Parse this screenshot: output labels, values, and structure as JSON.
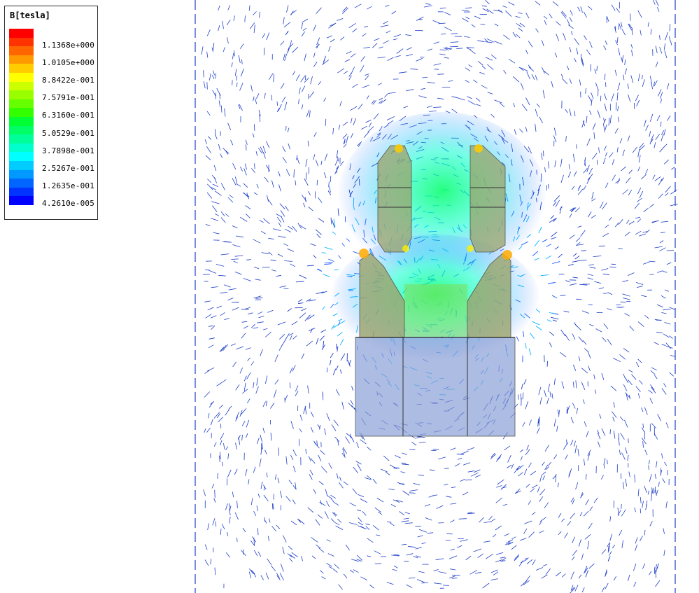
{
  "legend": {
    "title": "B[tesla]",
    "colors": [
      "#ff0000",
      "#ff3300",
      "#ff6600",
      "#ff9900",
      "#ffcc00",
      "#ffff00",
      "#ccff00",
      "#99ff00",
      "#66ff00",
      "#33ff00",
      "#00ff33",
      "#00ff66",
      "#00ff99",
      "#00ffcc",
      "#00ffff",
      "#00ccff",
      "#0099ff",
      "#0066ff",
      "#0033ff",
      "#0000ff"
    ],
    "labels": [
      "1.1368e+000",
      "1.0105e+000",
      "8.8422e-001",
      "7.5791e-001",
      "6.3160e-001",
      "5.0529e-001",
      "3.7898e-001",
      "2.5267e-001",
      "1.2635e-001",
      "4.2610e-005"
    ]
  },
  "scene": {
    "vector_color": "#1f3fc8",
    "part_color": "#9aa36a",
    "base_color": "#8a9fd6"
  }
}
